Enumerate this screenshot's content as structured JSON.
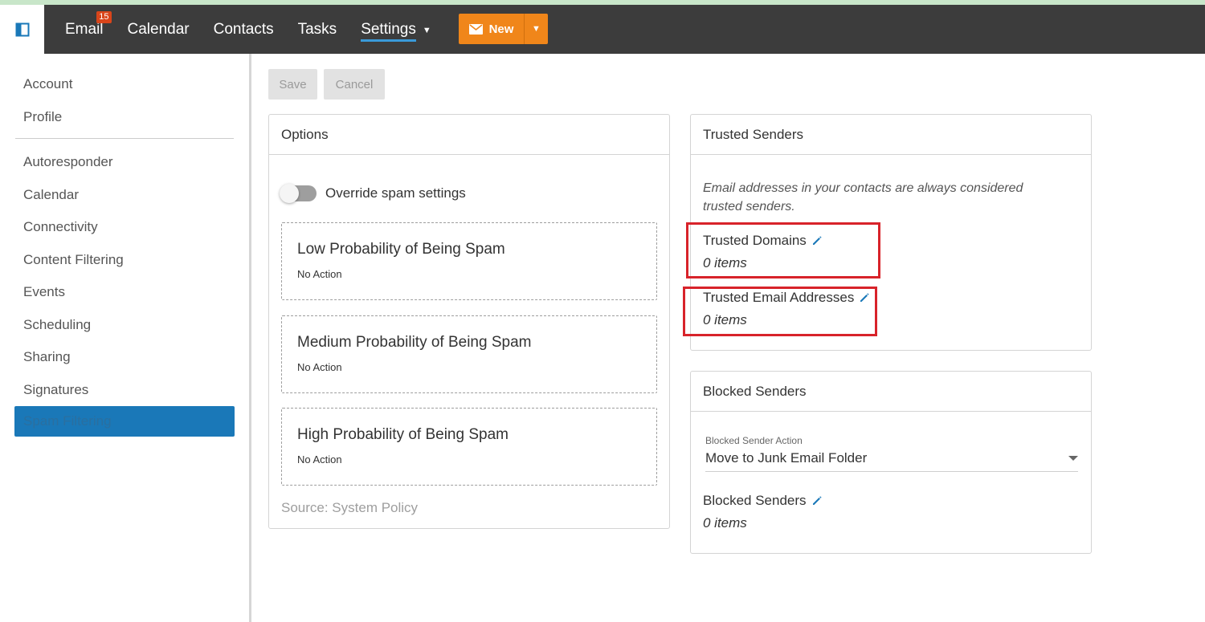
{
  "topbar": {
    "nav": [
      {
        "label": "Email",
        "badge": "15"
      },
      {
        "label": "Calendar"
      },
      {
        "label": "Contacts"
      },
      {
        "label": "Tasks"
      },
      {
        "label": "Settings"
      }
    ],
    "new_label": "New"
  },
  "sidebar": {
    "items": [
      "Account",
      "Profile",
      "Autoresponder",
      "Calendar",
      "Connectivity",
      "Content Filtering",
      "Events",
      "Scheduling",
      "Sharing",
      "Signatures",
      "Spam Filtering"
    ],
    "active_index": 10
  },
  "toolbar": {
    "save_label": "Save",
    "cancel_label": "Cancel"
  },
  "options": {
    "title": "Options",
    "override_label": "Override spam settings",
    "override_on": false,
    "levels": [
      {
        "title": "Low Probability of Being Spam",
        "action": "No Action"
      },
      {
        "title": "Medium Probability of Being Spam",
        "action": "No Action"
      },
      {
        "title": "High Probability of Being Spam",
        "action": "No Action"
      }
    ],
    "source": "Source: System Policy"
  },
  "trusted": {
    "title": "Trusted Senders",
    "description": "Email addresses in your contacts are always considered trusted senders.",
    "domains_label": "Trusted Domains",
    "domains_count": "0 items",
    "emails_label": "Trusted Email Addresses",
    "emails_count": "0 items"
  },
  "blocked": {
    "title": "Blocked Senders",
    "action_label": "Blocked Sender Action",
    "action_value": "Move to Junk Email Folder",
    "senders_label": "Blocked Senders",
    "senders_count": "0 items"
  },
  "colors": {
    "accent": "#1a78b8",
    "new_button": "#f0861a",
    "highlight": "#d8232a",
    "topbar": "#3c3c3c"
  }
}
